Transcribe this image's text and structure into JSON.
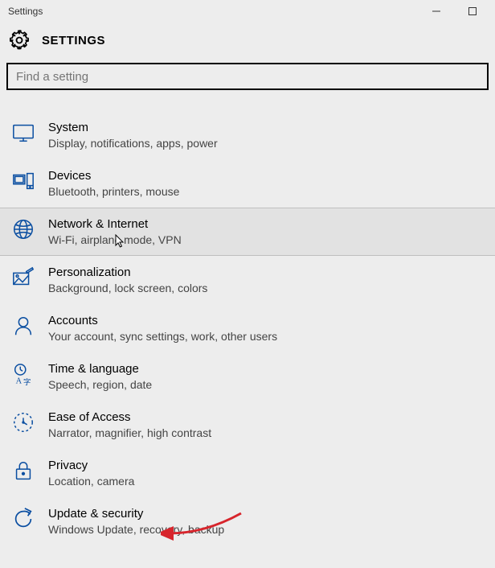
{
  "window": {
    "title": "Settings"
  },
  "header": {
    "heading": "SETTINGS"
  },
  "search": {
    "placeholder": "Find a setting"
  },
  "colors": {
    "accent": "#0a4ea1",
    "arrow": "#d7252c"
  },
  "items": [
    {
      "title": "System",
      "subtitle": "Display, notifications, apps, power"
    },
    {
      "title": "Devices",
      "subtitle": "Bluetooth, printers, mouse"
    },
    {
      "title": "Network & Internet",
      "subtitle": "Wi-Fi, airplane mode, VPN"
    },
    {
      "title": "Personalization",
      "subtitle": "Background, lock screen, colors"
    },
    {
      "title": "Accounts",
      "subtitle": "Your account, sync settings, work, other users"
    },
    {
      "title": "Time & language",
      "subtitle": "Speech, region, date"
    },
    {
      "title": "Ease of Access",
      "subtitle": "Narrator, magnifier, high contrast"
    },
    {
      "title": "Privacy",
      "subtitle": "Location, camera"
    },
    {
      "title": "Update & security",
      "subtitle": "Windows Update, recovery, backup"
    }
  ]
}
